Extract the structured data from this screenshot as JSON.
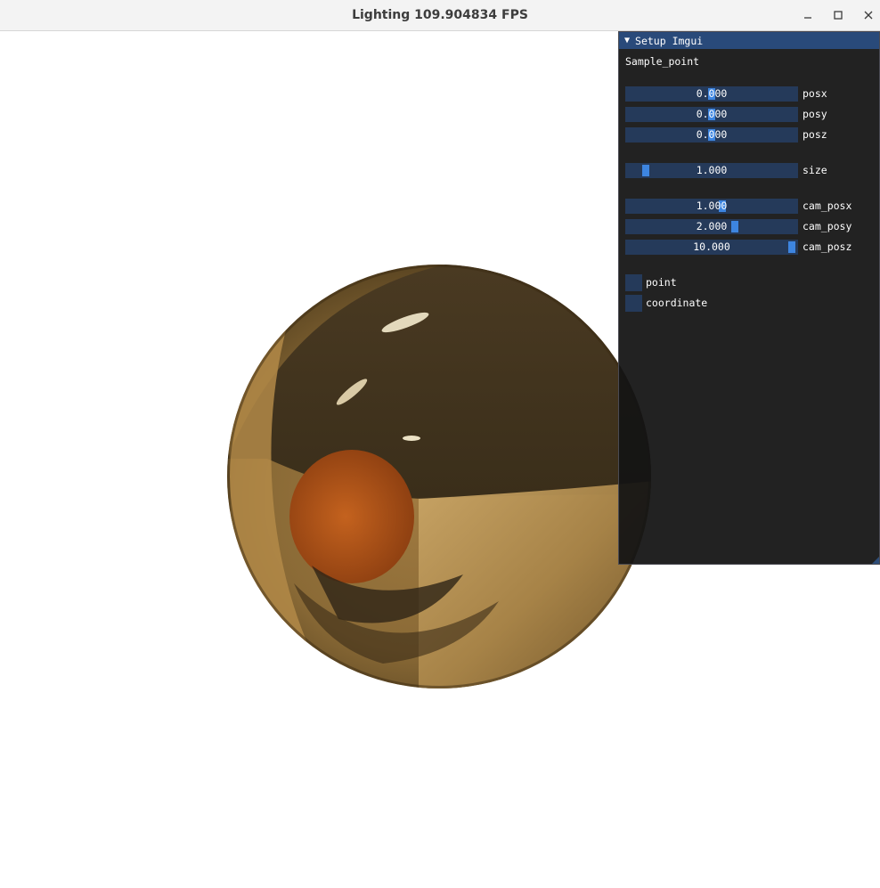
{
  "window": {
    "title": "Lighting  109.904834 FPS",
    "controls": {
      "minimize": "minimize-icon",
      "maximize": "maximize-icon",
      "close": "close-icon"
    }
  },
  "imgui": {
    "header_arrow": "▼",
    "title": "Setup Imgui",
    "section_label": "Sample_point",
    "sliders": [
      {
        "label": "posx",
        "value": "0.000",
        "fraction": 0.5
      },
      {
        "label": "posy",
        "value": "0.000",
        "fraction": 0.5
      },
      {
        "label": "posz",
        "value": "0.000",
        "fraction": 0.5
      },
      {
        "label": "size",
        "value": "1.000",
        "fraction": 0.1
      },
      {
        "label": "cam_posx",
        "value": "1.000",
        "fraction": 0.55
      },
      {
        "label": "cam_posy",
        "value": "2.000",
        "fraction": 0.6
      },
      {
        "label": "cam_posz",
        "value": "10.000",
        "fraction": 1.0
      }
    ],
    "checkboxes": [
      {
        "label": "point",
        "checked": false
      },
      {
        "label": "coordinate",
        "checked": false
      }
    ],
    "colors": {
      "header": "#294a7a",
      "frame": "#253a5a",
      "grab": "#3d85e0",
      "window_bg": "#141414"
    }
  },
  "scene": {
    "object": "reflective gold sphere",
    "background": "#ffffff"
  }
}
